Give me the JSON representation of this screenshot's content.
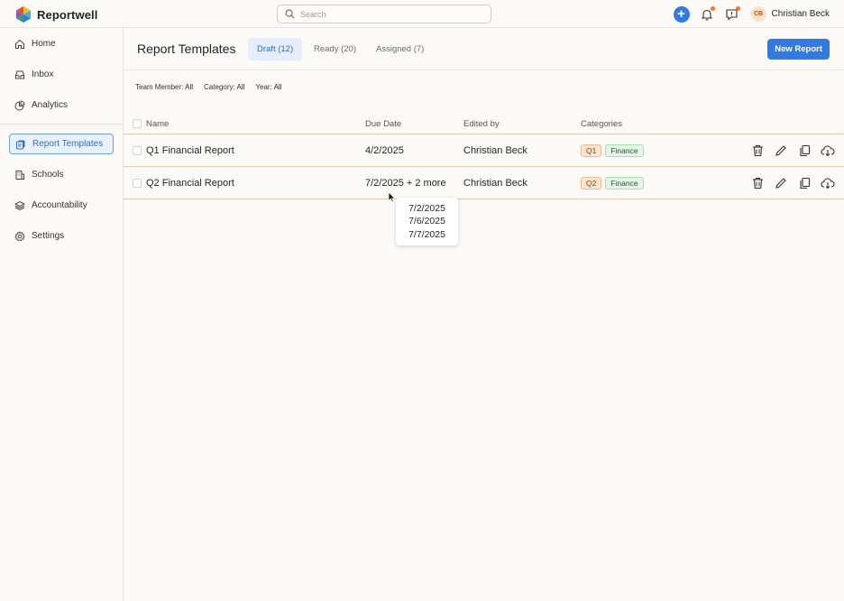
{
  "app": {
    "name": "Reportwell",
    "search_placeholder": "Search",
    "user": {
      "initials": "CB",
      "name": "Christian Beck"
    },
    "colors": {
      "accent": "#2f7be6",
      "notification_dot": "#f07b1f"
    }
  },
  "sidebar": {
    "items": [
      {
        "label": "Home",
        "icon": "home-icon",
        "active": false
      },
      {
        "label": "Inbox",
        "icon": "inbox-icon",
        "active": false
      },
      {
        "label": "Analytics",
        "icon": "analytics-icon",
        "active": false
      },
      {
        "label": "Report Templates",
        "icon": "report-templates-icon",
        "active": true
      },
      {
        "label": "Schools",
        "icon": "schools-icon",
        "active": false
      },
      {
        "label": "Accountability",
        "icon": "layers-icon",
        "active": false
      },
      {
        "label": "Settings",
        "icon": "gear-icon",
        "active": false
      }
    ]
  },
  "page": {
    "title": "Report Templates",
    "tabs": [
      {
        "label": "Draft (12)",
        "active": true
      },
      {
        "label": "Ready (20)",
        "active": false
      },
      {
        "label": "Assigned (7)",
        "active": false
      }
    ],
    "new_button": "New Report",
    "filters": [
      {
        "label": "Team Member:",
        "value": "All"
      },
      {
        "label": "Category:",
        "value": "All"
      },
      {
        "label": "Year:",
        "value": "All"
      }
    ]
  },
  "table": {
    "columns": [
      "Name",
      "Due Date",
      "Edited by",
      "Categories"
    ],
    "rows": [
      {
        "name": "Q1 Financial Report",
        "due": "4/2/2025",
        "editor": "Christian Beck",
        "tags": [
          "Q1",
          "Finance"
        ]
      },
      {
        "name": "Q2 Financial Report",
        "due": "7/2/2025 + 2 more",
        "editor": "Christian Beck",
        "tags": [
          "Q2",
          "Finance"
        ]
      }
    ]
  },
  "tooltip": {
    "dates": [
      "7/2/2025",
      "7/6/2025",
      "7/7/2025"
    ]
  }
}
